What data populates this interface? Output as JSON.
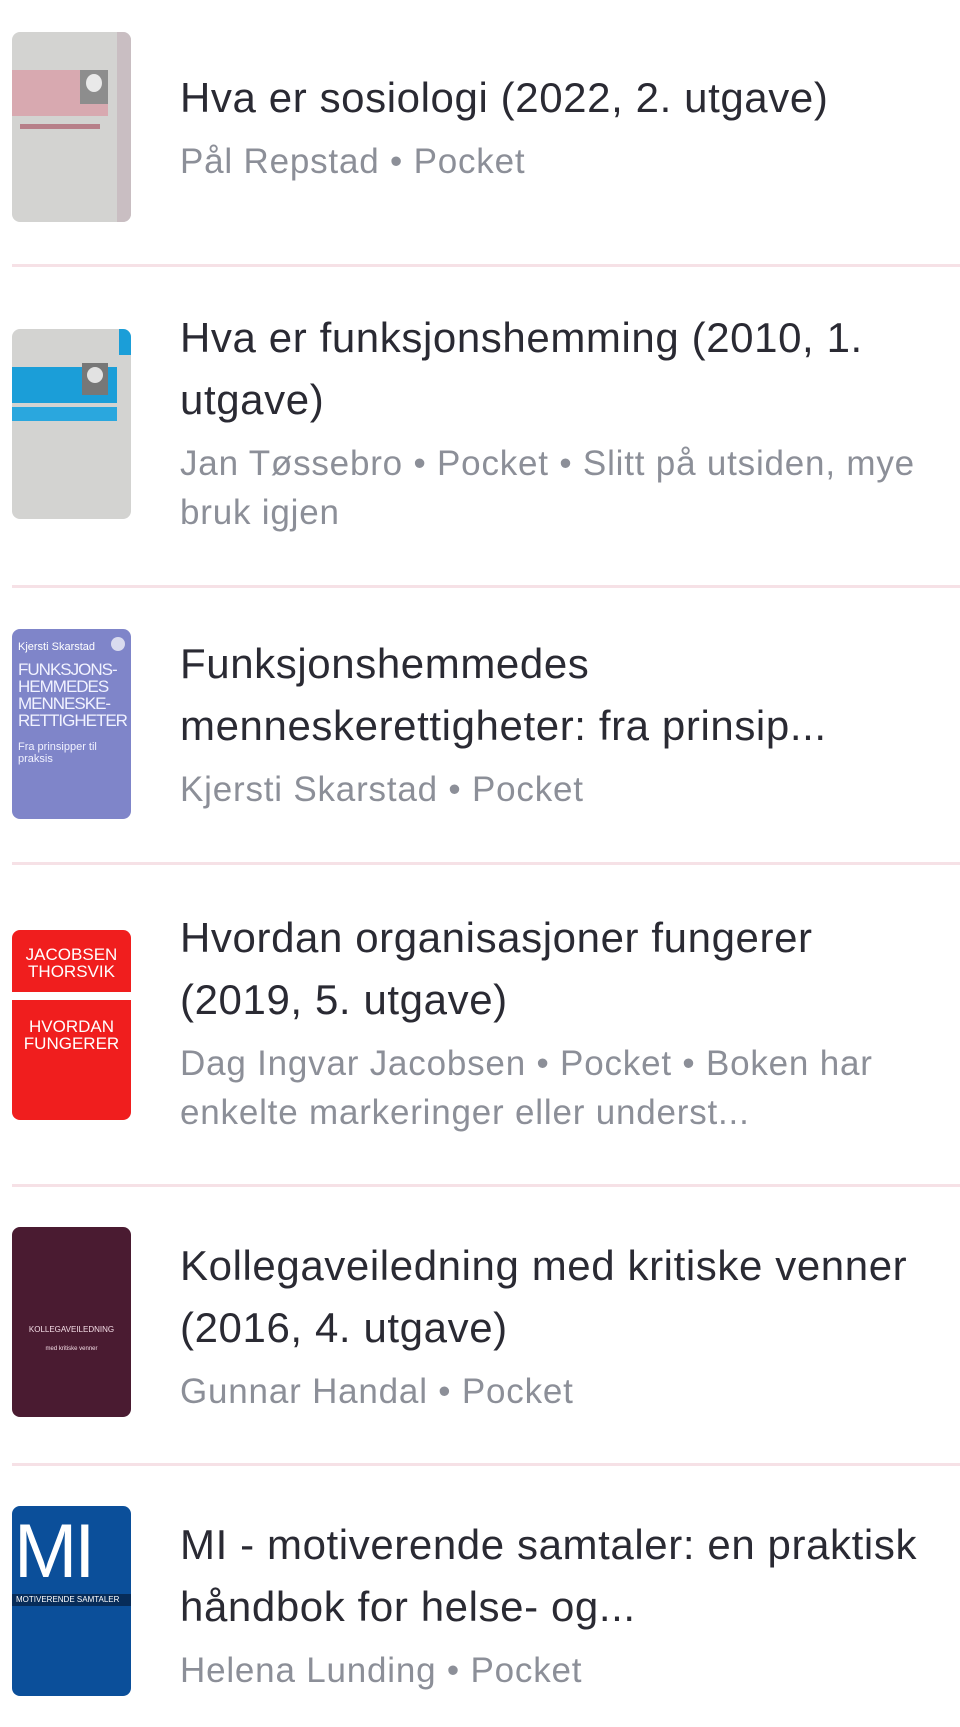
{
  "books": [
    {
      "title": "Hva er sosiologi (2022, 2. utgave)",
      "meta": "Pål Repstad • Pocket"
    },
    {
      "title": "Hva er funksjonshemming (2010, 1. utgave)",
      "meta": "Jan Tøssebro • Pocket • Slitt på utsiden, mye bruk igjen"
    },
    {
      "title": "Funksjonshemmedes menneskerettigheter: fra prinsip...",
      "meta": "Kjersti Skarstad • Pocket",
      "cover_text": {
        "author": "Kjersti Skarstad",
        "title_lines": "FUNKSJONS-HEMMEDES MENNESKE-RETTIGHETER",
        "subtitle": "Fra prinsipper til praksis"
      }
    },
    {
      "title": "Hvordan organisasjoner fungerer (2019, 5. utgave)",
      "meta": "Dag Ingvar Jacobsen • Pocket • Boken har enkelte markeringer eller underst...",
      "cover_text": {
        "authors": "JACOBSEN THORSVIK",
        "title": "HVORDAN FUNGERER"
      }
    },
    {
      "title": "Kollegaveiledning med kritiske venner (2016, 4. utgave)",
      "meta": "Gunnar Handal • Pocket",
      "cover_text": {
        "title": "KOLLEGAVEILEDNING",
        "subtitle": "med kritiske venner"
      }
    },
    {
      "title": "MI - motiverende samtaler: en praktisk håndbok for helse- og...",
      "meta": "Helena Lunding • Pocket",
      "cover_text": {
        "big": "MI",
        "title": "MOTIVERENDE SAMTALER"
      }
    }
  ]
}
